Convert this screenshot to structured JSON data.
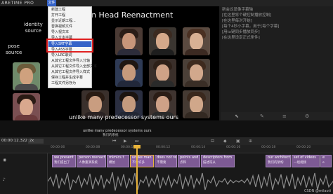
{
  "app": {
    "logo_text": "ARETIME PRO",
    "file_menu": "文件"
  },
  "preview": {
    "title": "n Head Reenactment",
    "identity_label_1": "identity",
    "identity_label_2": "source",
    "pose_label_1": "pose",
    "pose_label_2": "source",
    "caption": "unlike many predecessor systems ours"
  },
  "dropdown": {
    "items": [
      "新建工程",
      "打开工程",
      "显示近期工程...",
      "替换视频文件",
      "导入视文本",
      "导入文本字幕",
      "导入SRT字幕",
      "导入ASS字幕",
      "导入LRC歌词",
      "从其它工程文件导入分轴",
      "从其它工程文件导入全部文本",
      "从其它工程文件导入样式",
      "保存工程并生成字幕",
      "工程文件另存为"
    ],
    "highlighted_index": 6
  },
  "text_panel": {
    "lines": [
      "新会议显像字幕轴",
      "[在这里将个硬控制播放控制]",
      "[在这里每对开始]",
      "[每个4秒小字幕，用于[每个字幕]",
      "[用tx键同步播放同步]",
      "[在这里设定正式条件]"
    ]
  },
  "caption_strip": {
    "en": "unlike many predecessor systems ours",
    "zh": "我们的系统"
  },
  "controls": {
    "timecode": "00:00:12.322",
    "zoom": "2x"
  },
  "ruler": {
    "ticks": [
      "00:00:06",
      "00:00:08",
      "00:00:10",
      "00:00:12",
      "00:00:14",
      "00:00:16",
      "00:00:18",
      "00:00:20"
    ]
  },
  "clips": [
    {
      "en": "we present",
      "zh": "我们提出了"
    },
    {
      "en": "person reenact",
      "zh": "人像重演系统"
    },
    {
      "en": "mimics t",
      "zh": "模仿"
    },
    {
      "en": "unlike man",
      "zh": "不像许多"
    },
    {
      "en": "does not re",
      "zh": "不需要"
    },
    {
      "en": "points and",
      "zh": "点和"
    },
    {
      "en": "descriptors from",
      "zh": "描述符从"
    },
    {
      "en": "our architect",
      "zh": "我们的架构"
    },
    {
      "en": "set of videos",
      "zh": "一组视频"
    },
    {
      "en": "e",
      "zh": "e"
    }
  ],
  "watermark": "CSDN @milaoti"
}
